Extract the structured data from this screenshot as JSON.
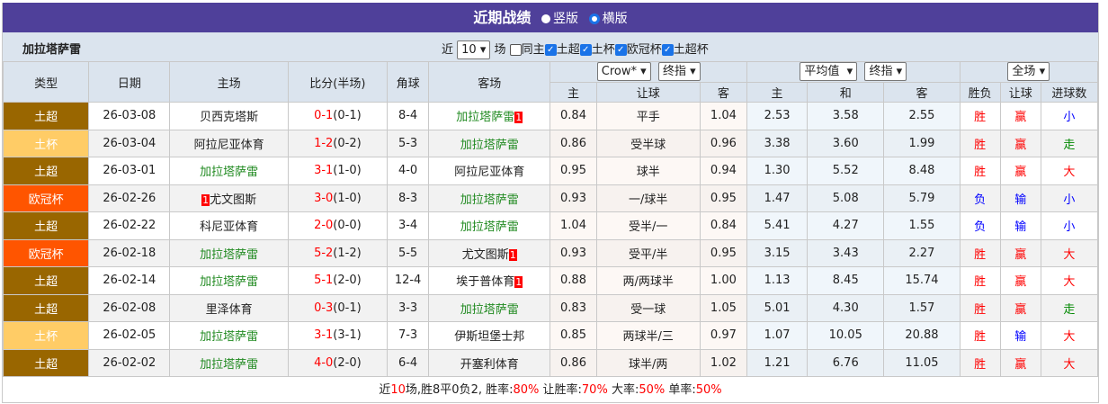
{
  "header": {
    "title": "近期战绩",
    "view_options": [
      {
        "label": "竖版",
        "selected": false
      },
      {
        "label": "横版",
        "selected": true
      }
    ]
  },
  "filter": {
    "team": "加拉塔萨雷",
    "prefix": "近",
    "count": "10",
    "suffix": "场",
    "checkboxes": [
      {
        "label": "同主",
        "checked": false
      },
      {
        "label": "土超",
        "checked": true
      },
      {
        "label": "土杯",
        "checked": true
      },
      {
        "label": "欧冠杯",
        "checked": true
      },
      {
        "label": "土超杯",
        "checked": true
      }
    ]
  },
  "columns": {
    "type": "类型",
    "date": "日期",
    "home": "主场",
    "score": "比分(半场)",
    "corner": "角球",
    "away": "客场",
    "company": "Crow*",
    "odds_type1": "终指",
    "avg": "平均值",
    "odds_type2": "终指",
    "scope": "全场",
    "h_home": "主",
    "h_line": "让球",
    "h_away": "客",
    "e_home": "主",
    "e_draw": "和",
    "e_away": "客",
    "r_wl": "胜负",
    "r_hcp": "让球",
    "r_ou": "进球数"
  },
  "colors": {
    "土超": "#996600",
    "土杯": "#ffcc66",
    "欧冠杯": "#ff5500",
    "team": "#228b22",
    "win": "#ff0000",
    "loss": "#0000ff",
    "push": "#008800"
  },
  "rows": [
    {
      "type": "土超",
      "date": "26-03-08",
      "home": "贝西克塔斯",
      "home_rc": "",
      "score": "0-1",
      "half": "(0-1)",
      "corner": "8-4",
      "away": "加拉塔萨雷",
      "away_rc": "1",
      "h1": "0.84",
      "hl": "平手",
      "h2": "1.04",
      "e1": "2.53",
      "ed": "3.58",
      "e2": "2.55",
      "wl": "胜",
      "hc": "赢",
      "ou": "小"
    },
    {
      "type": "土杯",
      "date": "26-03-04",
      "home": "阿拉尼亚体育",
      "home_rc": "",
      "score": "1-2",
      "half": "(0-2)",
      "corner": "5-3",
      "away": "加拉塔萨雷",
      "away_rc": "",
      "h1": "0.86",
      "hl": "受半球",
      "h2": "0.96",
      "e1": "3.38",
      "ed": "3.60",
      "e2": "1.99",
      "wl": "胜",
      "hc": "赢",
      "ou": "走"
    },
    {
      "type": "土超",
      "date": "26-03-01",
      "home": "加拉塔萨雷",
      "home_rc": "",
      "score": "3-1",
      "half": "(1-0)",
      "corner": "4-0",
      "away": "阿拉尼亚体育",
      "away_rc": "",
      "h1": "0.95",
      "hl": "球半",
      "h2": "0.94",
      "e1": "1.30",
      "ed": "5.52",
      "e2": "8.48",
      "wl": "胜",
      "hc": "赢",
      "ou": "大"
    },
    {
      "type": "欧冠杯",
      "date": "26-02-26",
      "home": "尤文图斯",
      "home_rc": "1",
      "score": "3-0",
      "half": "(1-0)",
      "corner": "8-3",
      "away": "加拉塔萨雷",
      "away_rc": "",
      "h1": "0.93",
      "hl": "一/球半",
      "h2": "0.95",
      "e1": "1.47",
      "ed": "5.08",
      "e2": "5.79",
      "wl": "负",
      "hc": "输",
      "ou": "小"
    },
    {
      "type": "土超",
      "date": "26-02-22",
      "home": "科尼亚体育",
      "home_rc": "",
      "score": "2-0",
      "half": "(0-0)",
      "corner": "3-4",
      "away": "加拉塔萨雷",
      "away_rc": "",
      "h1": "1.04",
      "hl": "受半/一",
      "h2": "0.84",
      "e1": "5.41",
      "ed": "4.27",
      "e2": "1.55",
      "wl": "负",
      "hc": "输",
      "ou": "小"
    },
    {
      "type": "欧冠杯",
      "date": "26-02-18",
      "home": "加拉塔萨雷",
      "home_rc": "",
      "score": "5-2",
      "half": "(1-2)",
      "corner": "5-5",
      "away": "尤文图斯",
      "away_rc": "1",
      "h1": "0.93",
      "hl": "受平/半",
      "h2": "0.95",
      "e1": "3.15",
      "ed": "3.43",
      "e2": "2.27",
      "wl": "胜",
      "hc": "赢",
      "ou": "大"
    },
    {
      "type": "土超",
      "date": "26-02-14",
      "home": "加拉塔萨雷",
      "home_rc": "",
      "score": "5-1",
      "half": "(2-0)",
      "corner": "12-4",
      "away": "埃于普体育",
      "away_rc": "1",
      "h1": "0.88",
      "hl": "两/两球半",
      "h2": "1.00",
      "e1": "1.13",
      "ed": "8.45",
      "e2": "15.74",
      "wl": "胜",
      "hc": "赢",
      "ou": "大"
    },
    {
      "type": "土超",
      "date": "26-02-08",
      "home": "里泽体育",
      "home_rc": "",
      "score": "0-3",
      "half": "(0-1)",
      "corner": "3-3",
      "away": "加拉塔萨雷",
      "away_rc": "",
      "h1": "0.83",
      "hl": "受一球",
      "h2": "1.05",
      "e1": "5.01",
      "ed": "4.30",
      "e2": "1.57",
      "wl": "胜",
      "hc": "赢",
      "ou": "走"
    },
    {
      "type": "土杯",
      "date": "26-02-05",
      "home": "加拉塔萨雷",
      "home_rc": "",
      "score": "3-1",
      "half": "(3-1)",
      "corner": "7-3",
      "away": "伊斯坦堡士邦",
      "away_rc": "",
      "h1": "0.85",
      "hl": "两球半/三",
      "h2": "0.97",
      "e1": "1.07",
      "ed": "10.05",
      "e2": "20.88",
      "wl": "胜",
      "hc": "输",
      "ou": "大"
    },
    {
      "type": "土超",
      "date": "26-02-02",
      "home": "加拉塔萨雷",
      "home_rc": "",
      "score": "4-0",
      "half": "(2-0)",
      "corner": "6-4",
      "away": "开塞利体育",
      "away_rc": "",
      "h1": "0.86",
      "hl": "球半/两",
      "h2": "1.02",
      "e1": "1.21",
      "ed": "6.76",
      "e2": "11.05",
      "wl": "胜",
      "hc": "赢",
      "ou": "大"
    }
  ],
  "footer": {
    "p1": "近",
    "n": "10",
    "p2": "场,胜8平0负2, 胜率:",
    "win": "80%",
    "p3": " 让胜率:",
    "hwin": "70%",
    "p4": " 大率:",
    "big": "50%",
    "p5": " 单率:",
    "odd": "50%"
  }
}
